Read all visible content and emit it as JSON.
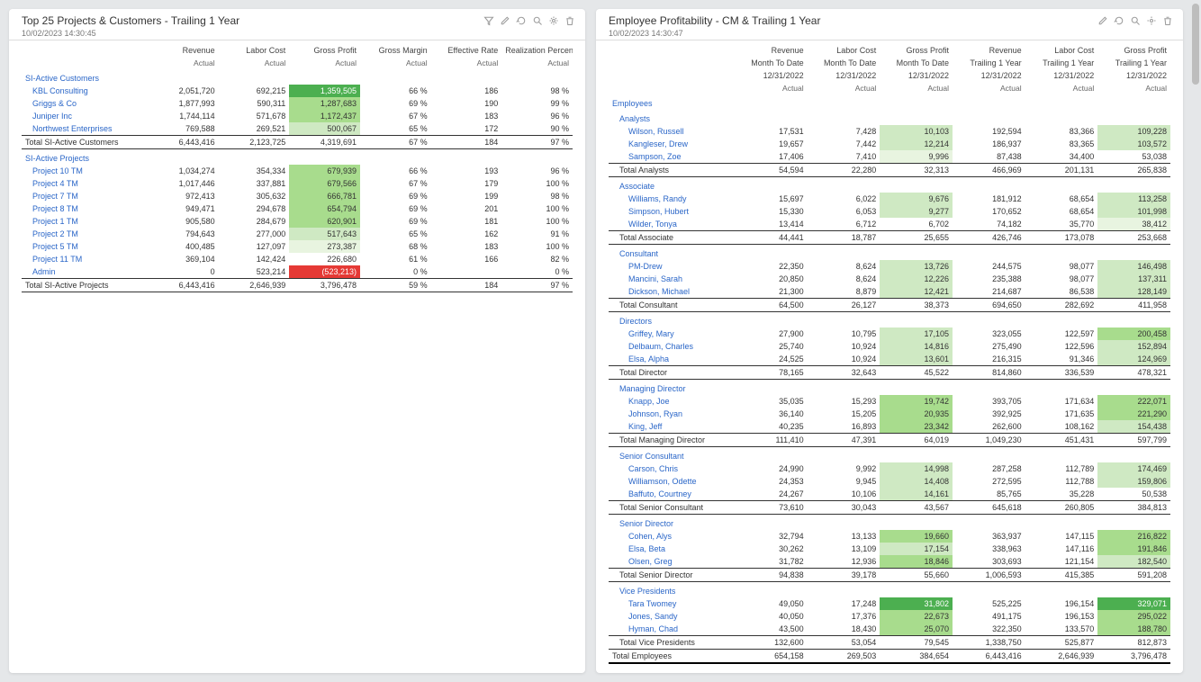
{
  "left_panel": {
    "title": "Top 25 Projects & Customers - Trailing 1 Year",
    "timestamp": "10/02/2023 14:30:45",
    "columns": [
      "",
      "Revenue",
      "Labor Cost",
      "Gross Profit",
      "Gross Margin",
      "Effective Rate",
      "Realization Percentage"
    ],
    "sub_columns": [
      "",
      "Actual",
      "Actual",
      "Actual",
      "Actual",
      "Actual",
      "Actual"
    ],
    "sections": [
      {
        "header": "SI-Active Customers",
        "rows": [
          {
            "label": "KBL Consulting",
            "rev": "2,051,720",
            "lc": "692,215",
            "gp": "1,359,505",
            "gp_hl": "g3",
            "gm": "66 %",
            "er": "186",
            "rp": "98 %"
          },
          {
            "label": "Griggs & Co",
            "rev": "1,877,993",
            "lc": "590,311",
            "gp": "1,287,683",
            "gp_hl": "g2",
            "gm": "69 %",
            "er": "190",
            "rp": "99 %"
          },
          {
            "label": "Juniper Inc",
            "rev": "1,744,114",
            "lc": "571,678",
            "gp": "1,172,437",
            "gp_hl": "g2",
            "gm": "67 %",
            "er": "183",
            "rp": "96 %"
          },
          {
            "label": "Northwest Enterprises",
            "rev": "769,588",
            "lc": "269,521",
            "gp": "500,067",
            "gp_hl": "g1",
            "gm": "65 %",
            "er": "172",
            "rp": "90 %"
          }
        ],
        "total": {
          "label": "Total SI-Active Customers",
          "rev": "6,443,416",
          "lc": "2,123,725",
          "gp": "4,319,691",
          "gm": "67 %",
          "er": "184",
          "rp": "97 %"
        }
      },
      {
        "header": "SI-Active Projects",
        "rows": [
          {
            "label": "Project 10 TM",
            "rev": "1,034,274",
            "lc": "354,334",
            "gp": "679,939",
            "gp_hl": "g2",
            "gm": "66 %",
            "er": "193",
            "rp": "96 %"
          },
          {
            "label": "Project 4 TM",
            "rev": "1,017,446",
            "lc": "337,881",
            "gp": "679,566",
            "gp_hl": "g2",
            "gm": "67 %",
            "er": "179",
            "rp": "100 %"
          },
          {
            "label": "Project 7 TM",
            "rev": "972,413",
            "lc": "305,632",
            "gp": "666,781",
            "gp_hl": "g2",
            "gm": "69 %",
            "er": "199",
            "rp": "98 %"
          },
          {
            "label": "Project 8 TM",
            "rev": "949,471",
            "lc": "294,678",
            "gp": "654,794",
            "gp_hl": "g2",
            "gm": "69 %",
            "er": "201",
            "rp": "100 %"
          },
          {
            "label": "Project 1 TM",
            "rev": "905,580",
            "lc": "284,679",
            "gp": "620,901",
            "gp_hl": "g2",
            "gm": "69 %",
            "er": "181",
            "rp": "100 %"
          },
          {
            "label": "Project 2 TM",
            "rev": "794,643",
            "lc": "277,000",
            "gp": "517,643",
            "gp_hl": "g1",
            "gm": "65 %",
            "er": "162",
            "rp": "91 %"
          },
          {
            "label": "Project 5 TM",
            "rev": "400,485",
            "lc": "127,097",
            "gp": "273,387",
            "gp_hl": "g0",
            "gm": "68 %",
            "er": "183",
            "rp": "100 %"
          },
          {
            "label": "Project 11 TM",
            "rev": "369,104",
            "lc": "142,424",
            "gp": "226,680",
            "gp_hl": "",
            "gm": "61 %",
            "er": "166",
            "rp": "82 %"
          },
          {
            "label": "Admin",
            "rev": "0",
            "lc": "523,214",
            "gp": "(523,213)",
            "gp_hl": "r",
            "gm": "0 %",
            "er": "",
            "rp": "0 %"
          }
        ],
        "total": {
          "label": "Total SI-Active Projects",
          "rev": "6,443,416",
          "lc": "2,646,939",
          "gp": "3,796,478",
          "gm": "59 %",
          "er": "184",
          "rp": "97 %"
        }
      }
    ]
  },
  "right_panel": {
    "title": "Employee Profitability - CM & Trailing 1 Year",
    "timestamp": "10/02/2023 14:30:47",
    "col_groups": [
      {
        "metric": "Revenue",
        "period": "Month To Date",
        "date": "12/31/2022",
        "sub": "Actual"
      },
      {
        "metric": "Labor Cost",
        "period": "Month To Date",
        "date": "12/31/2022",
        "sub": "Actual"
      },
      {
        "metric": "Gross Profit",
        "period": "Month To Date",
        "date": "12/31/2022",
        "sub": "Actual"
      },
      {
        "metric": "Revenue",
        "period": "Trailing 1 Year",
        "date": "12/31/2022",
        "sub": "Actual"
      },
      {
        "metric": "Labor Cost",
        "period": "Trailing 1 Year",
        "date": "12/31/2022",
        "sub": "Actual"
      },
      {
        "metric": "Gross Profit",
        "period": "Trailing 1 Year",
        "date": "12/31/2022",
        "sub": "Actual"
      }
    ],
    "root": "Employees",
    "groups": [
      {
        "header": "Analysts",
        "rows": [
          {
            "label": "Wilson, Russell",
            "c": [
              "17,531",
              "7,428",
              "10,103",
              "192,594",
              "83,366",
              "109,228"
            ],
            "hl": [
              null,
              null,
              "g1",
              null,
              null,
              "g1"
            ]
          },
          {
            "label": "Kangleser, Drew",
            "c": [
              "19,657",
              "7,442",
              "12,214",
              "186,937",
              "83,365",
              "103,572"
            ],
            "hl": [
              null,
              null,
              "g1",
              null,
              null,
              "g1"
            ]
          },
          {
            "label": "Sampson, Zoe",
            "c": [
              "17,406",
              "7,410",
              "9,996",
              "87,438",
              "34,400",
              "53,038"
            ],
            "hl": [
              null,
              null,
              "g0",
              null,
              null,
              null
            ]
          }
        ],
        "total": {
          "label": "Total Analysts",
          "c": [
            "54,594",
            "22,280",
            "32,313",
            "466,969",
            "201,131",
            "265,838"
          ]
        }
      },
      {
        "header": "Associate",
        "rows": [
          {
            "label": "Williams, Randy",
            "c": [
              "15,697",
              "6,022",
              "9,676",
              "181,912",
              "68,654",
              "113,258"
            ],
            "hl": [
              null,
              null,
              "g1",
              null,
              null,
              "g1"
            ]
          },
          {
            "label": "Simpson, Hubert",
            "c": [
              "15,330",
              "6,053",
              "9,277",
              "170,652",
              "68,654",
              "101,998"
            ],
            "hl": [
              null,
              null,
              "g1",
              null,
              null,
              "g1"
            ]
          },
          {
            "label": "Wilder, Tonya",
            "c": [
              "13,414",
              "6,712",
              "6,702",
              "74,182",
              "35,770",
              "38,412"
            ],
            "hl": [
              null,
              null,
              null,
              null,
              null,
              "g0"
            ]
          }
        ],
        "total": {
          "label": "Total Associate",
          "c": [
            "44,441",
            "18,787",
            "25,655",
            "426,746",
            "173,078",
            "253,668"
          ]
        }
      },
      {
        "header": "Consultant",
        "rows": [
          {
            "label": "PM-Drew",
            "c": [
              "22,350",
              "8,624",
              "13,726",
              "244,575",
              "98,077",
              "146,498"
            ],
            "hl": [
              null,
              null,
              "g1",
              null,
              null,
              "g1"
            ]
          },
          {
            "label": "Mancini, Sarah",
            "c": [
              "20,850",
              "8,624",
              "12,226",
              "235,388",
              "98,077",
              "137,311"
            ],
            "hl": [
              null,
              null,
              "g1",
              null,
              null,
              "g1"
            ]
          },
          {
            "label": "Dickson, Michael",
            "c": [
              "21,300",
              "8,879",
              "12,421",
              "214,687",
              "86,538",
              "128,149"
            ],
            "hl": [
              null,
              null,
              "g1",
              null,
              null,
              "g1"
            ]
          }
        ],
        "total": {
          "label": "Total Consultant",
          "c": [
            "64,500",
            "26,127",
            "38,373",
            "694,650",
            "282,692",
            "411,958"
          ]
        }
      },
      {
        "header": "Directors",
        "rows": [
          {
            "label": "Griffey, Mary",
            "c": [
              "27,900",
              "10,795",
              "17,105",
              "323,055",
              "122,597",
              "200,458"
            ],
            "hl": [
              null,
              null,
              "g1",
              null,
              null,
              "g2"
            ]
          },
          {
            "label": "Delbaum, Charles",
            "c": [
              "25,740",
              "10,924",
              "14,816",
              "275,490",
              "122,596",
              "152,894"
            ],
            "hl": [
              null,
              null,
              "g1",
              null,
              null,
              "g1"
            ]
          },
          {
            "label": "Elsa, Alpha",
            "c": [
              "24,525",
              "10,924",
              "13,601",
              "216,315",
              "91,346",
              "124,969"
            ],
            "hl": [
              null,
              null,
              "g1",
              null,
              null,
              "g1"
            ]
          }
        ],
        "total": {
          "label": "Total Director",
          "c": [
            "78,165",
            "32,643",
            "45,522",
            "814,860",
            "336,539",
            "478,321"
          ]
        }
      },
      {
        "header": "Managing Director",
        "rows": [
          {
            "label": "Knapp, Joe",
            "c": [
              "35,035",
              "15,293",
              "19,742",
              "393,705",
              "171,634",
              "222,071"
            ],
            "hl": [
              null,
              null,
              "g2",
              null,
              null,
              "g2"
            ]
          },
          {
            "label": "Johnson, Ryan",
            "c": [
              "36,140",
              "15,205",
              "20,935",
              "392,925",
              "171,635",
              "221,290"
            ],
            "hl": [
              null,
              null,
              "g2",
              null,
              null,
              "g2"
            ]
          },
          {
            "label": "King, Jeff",
            "c": [
              "40,235",
              "16,893",
              "23,342",
              "262,600",
              "108,162",
              "154,438"
            ],
            "hl": [
              null,
              null,
              "g2",
              null,
              null,
              "g1"
            ]
          }
        ],
        "total": {
          "label": "Total Managing Director",
          "c": [
            "111,410",
            "47,391",
            "64,019",
            "1,049,230",
            "451,431",
            "597,799"
          ]
        }
      },
      {
        "header": "Senior Consultant",
        "rows": [
          {
            "label": "Carson, Chris",
            "c": [
              "24,990",
              "9,992",
              "14,998",
              "287,258",
              "112,789",
              "174,469"
            ],
            "hl": [
              null,
              null,
              "g1",
              null,
              null,
              "g1"
            ]
          },
          {
            "label": "Williamson, Odette",
            "c": [
              "24,353",
              "9,945",
              "14,408",
              "272,595",
              "112,788",
              "159,806"
            ],
            "hl": [
              null,
              null,
              "g1",
              null,
              null,
              "g1"
            ]
          },
          {
            "label": "Baffuto, Courtney",
            "c": [
              "24,267",
              "10,106",
              "14,161",
              "85,765",
              "35,228",
              "50,538"
            ],
            "hl": [
              null,
              null,
              "g1",
              null,
              null,
              null
            ]
          }
        ],
        "total": {
          "label": "Total Senior Consultant",
          "c": [
            "73,610",
            "30,043",
            "43,567",
            "645,618",
            "260,805",
            "384,813"
          ]
        }
      },
      {
        "header": "Senior Director",
        "rows": [
          {
            "label": "Cohen, Alys",
            "c": [
              "32,794",
              "13,133",
              "19,660",
              "363,937",
              "147,115",
              "216,822"
            ],
            "hl": [
              null,
              null,
              "g2",
              null,
              null,
              "g2"
            ]
          },
          {
            "label": "Elsa, Beta",
            "c": [
              "30,262",
              "13,109",
              "17,154",
              "338,963",
              "147,116",
              "191,846"
            ],
            "hl": [
              null,
              null,
              "g1",
              null,
              null,
              "g2"
            ]
          },
          {
            "label": "Olsen, Greg",
            "c": [
              "31,782",
              "12,936",
              "18,846",
              "303,693",
              "121,154",
              "182,540"
            ],
            "hl": [
              null,
              null,
              "g2",
              null,
              null,
              "g1"
            ]
          }
        ],
        "total": {
          "label": "Total Senior Director",
          "c": [
            "94,838",
            "39,178",
            "55,660",
            "1,006,593",
            "415,385",
            "591,208"
          ]
        }
      },
      {
        "header": "Vice Presidents",
        "rows": [
          {
            "label": "Tara Twomey",
            "c": [
              "49,050",
              "17,248",
              "31,802",
              "525,225",
              "196,154",
              "329,071"
            ],
            "hl": [
              null,
              null,
              "g3",
              null,
              null,
              "g3"
            ]
          },
          {
            "label": "Jones, Sandy",
            "c": [
              "40,050",
              "17,376",
              "22,673",
              "491,175",
              "196,153",
              "295,022"
            ],
            "hl": [
              null,
              null,
              "g2",
              null,
              null,
              "g2"
            ]
          },
          {
            "label": "Hyman, Chad",
            "c": [
              "43,500",
              "18,430",
              "25,070",
              "322,350",
              "133,570",
              "188,780"
            ],
            "hl": [
              null,
              null,
              "g2",
              null,
              null,
              "g2"
            ]
          }
        ],
        "total": {
          "label": "Total Vice Presidents",
          "c": [
            "132,600",
            "53,054",
            "79,545",
            "1,338,750",
            "525,877",
            "812,873"
          ]
        }
      }
    ],
    "grand_total": {
      "label": "Total Employees",
      "c": [
        "654,158",
        "269,503",
        "384,654",
        "6,443,416",
        "2,646,939",
        "3,796,478"
      ]
    }
  }
}
